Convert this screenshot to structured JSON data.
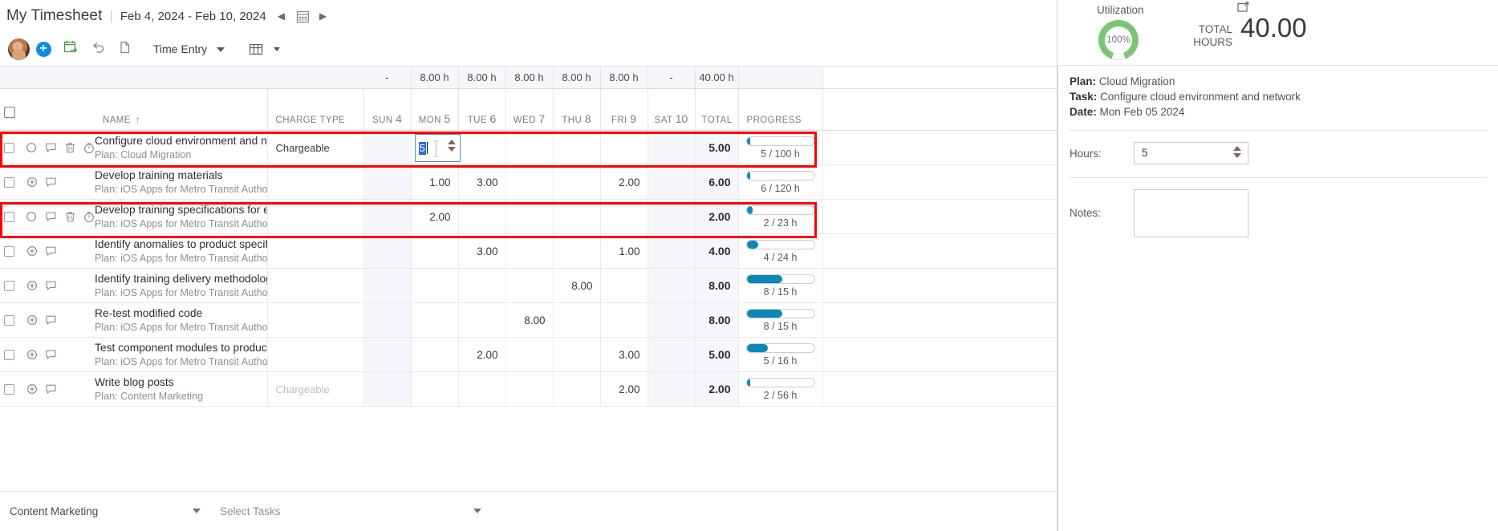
{
  "header": {
    "app_title": "My Timesheet",
    "separator": "|",
    "date_range": "Feb 4, 2024 - Feb 10, 2024",
    "prev_arrow": "◀",
    "next_arrow": "▶",
    "calendar_icon": "calendar-icon"
  },
  "toolbar": {
    "avatar": "user-avatar",
    "add_label": "+",
    "icons": [
      "add-entry-icon",
      "calendar-add-icon",
      "undo-icon",
      "copy-icon"
    ],
    "time_entry_label": "Time Entry",
    "view_icon": "grid-view-icon"
  },
  "grid": {
    "summary": {
      "sun": "-",
      "days": [
        "8.00 h",
        "8.00 h",
        "8.00 h",
        "8.00 h",
        "8.00 h"
      ],
      "sat": "-",
      "total": "40.00 h"
    },
    "columns": {
      "name": "NAME",
      "sort_indicator": "↑",
      "charge_type": "CHARGE TYPE",
      "sun": "SUN",
      "sun_num": "4",
      "mon": "MON",
      "mon_num": "5",
      "tue": "TUE",
      "tue_num": "6",
      "wed": "WED",
      "wed_num": "7",
      "thu": "THU",
      "thu_num": "8",
      "fri": "FRI",
      "fri_num": "9",
      "sat": "SAT",
      "sat_num": "10",
      "total": "TOTAL",
      "progress": "PROGRESS"
    },
    "rows": [
      {
        "name": "Configure cloud environment and netw",
        "plan": "Plan: Cloud Migration",
        "charge_type": "Chargeable",
        "charge_dim": false,
        "highlighted": true,
        "icons": [
          "status-circle-icon",
          "comment-icon",
          "delete-icon",
          "timer-icon"
        ],
        "sun": "",
        "mon": "",
        "tue": "",
        "wed": "",
        "thu": "",
        "fri": "",
        "sat": "",
        "editing_day": "mon",
        "edit_value": "5",
        "total": "5.00",
        "progress_label": "5 / 100 h",
        "progress_pct": 5
      },
      {
        "name": "Develop training materials",
        "plan": "Plan: iOS Apps for Metro Transit Author",
        "charge_type": "",
        "charge_dim": false,
        "highlighted": false,
        "icons": [
          "add-circle-icon",
          "comment-icon"
        ],
        "sun": "",
        "mon": "1.00",
        "tue": "3.00",
        "wed": "",
        "thu": "",
        "fri": "2.00",
        "sat": "",
        "editing_day": "",
        "edit_value": "",
        "total": "6.00",
        "progress_label": "6 / 120 h",
        "progress_pct": 5
      },
      {
        "name": "Develop training specifications for end u",
        "plan": "Plan: iOS Apps for Metro Transit Author",
        "charge_type": "",
        "charge_dim": false,
        "highlighted": true,
        "icons": [
          "status-circle-icon",
          "comment-icon",
          "delete-icon",
          "timer-icon"
        ],
        "sun": "",
        "mon": "2.00",
        "tue": "",
        "wed": "",
        "thu": "",
        "fri": "",
        "sat": "",
        "editing_day": "",
        "edit_value": "",
        "total": "2.00",
        "progress_label": "2 / 23 h",
        "progress_pct": 9
      },
      {
        "name": "Identify anomalies to product specificat",
        "plan": "Plan: iOS Apps for Metro Transit Author",
        "charge_type": "",
        "charge_dim": false,
        "highlighted": false,
        "icons": [
          "add-circle-icon",
          "comment-icon"
        ],
        "sun": "",
        "mon": "",
        "tue": "3.00",
        "wed": "",
        "thu": "",
        "fri": "1.00",
        "sat": "",
        "editing_day": "",
        "edit_value": "",
        "total": "4.00",
        "progress_label": "4 / 24 h",
        "progress_pct": 17
      },
      {
        "name": "Identify training delivery methodology (",
        "plan": "Plan: iOS Apps for Metro Transit Author",
        "charge_type": "",
        "charge_dim": false,
        "highlighted": false,
        "icons": [
          "add-circle-icon",
          "comment-icon"
        ],
        "sun": "",
        "mon": "",
        "tue": "",
        "wed": "",
        "thu": "8.00",
        "fri": "",
        "sat": "",
        "editing_day": "",
        "edit_value": "",
        "total": "8.00",
        "progress_label": "8 / 15 h",
        "progress_pct": 53
      },
      {
        "name": "Re-test modified code",
        "plan": "Plan: iOS Apps for Metro Transit Author",
        "charge_type": "",
        "charge_dim": false,
        "highlighted": false,
        "icons": [
          "add-circle-icon",
          "comment-icon"
        ],
        "sun": "",
        "mon": "",
        "tue": "",
        "wed": "8.00",
        "thu": "",
        "fri": "",
        "sat": "",
        "editing_day": "",
        "edit_value": "",
        "total": "8.00",
        "progress_label": "8 / 15 h",
        "progress_pct": 53
      },
      {
        "name": "Test component modules to product sp",
        "plan": "Plan: iOS Apps for Metro Transit Author",
        "charge_type": "",
        "charge_dim": false,
        "highlighted": false,
        "icons": [
          "add-circle-icon",
          "comment-icon"
        ],
        "sun": "",
        "mon": "",
        "tue": "2.00",
        "wed": "",
        "thu": "",
        "fri": "3.00",
        "sat": "",
        "editing_day": "",
        "edit_value": "",
        "total": "5.00",
        "progress_label": "5 / 16 h",
        "progress_pct": 31
      },
      {
        "name": "Write blog posts",
        "plan": "Plan: Content Marketing",
        "charge_type": "Chargeable",
        "charge_dim": true,
        "highlighted": false,
        "icons": [
          "add-circle-icon",
          "comment-icon"
        ],
        "sun": "",
        "mon": "",
        "tue": "",
        "wed": "",
        "thu": "",
        "fri": "2.00",
        "sat": "",
        "editing_day": "",
        "edit_value": "",
        "total": "2.00",
        "progress_label": "2 / 56 h",
        "progress_pct": 4
      }
    ]
  },
  "bottom_bar": {
    "plan_select_value": "Content Marketing",
    "task_select_placeholder": "Select Tasks"
  },
  "utilization": {
    "label": "Utilization",
    "percent_text": "100%",
    "percent_value": 100,
    "gauge_color": "#7cc576",
    "total_hours_label_line1": "TOTAL",
    "total_hours_label_line2": "HOURS",
    "total_hours_value": "40.00",
    "expand_icon": "expand-panel-icon"
  },
  "detail": {
    "plan_label": "Plan:",
    "plan_value": "Cloud Migration",
    "task_label": "Task:",
    "task_value": "Configure cloud environment and network",
    "date_label": "Date:",
    "date_value": "Mon Feb 05 2024",
    "hours_label": "Hours:",
    "hours_value": "5",
    "notes_label": "Notes:",
    "notes_value": ""
  },
  "colors": {
    "accent_blue": "#0c8ce9",
    "progress_blue": "#0d86b8",
    "highlight_red": "#ff0000",
    "gauge_green": "#7cc576",
    "selection_blue": "#2a6fd1"
  }
}
